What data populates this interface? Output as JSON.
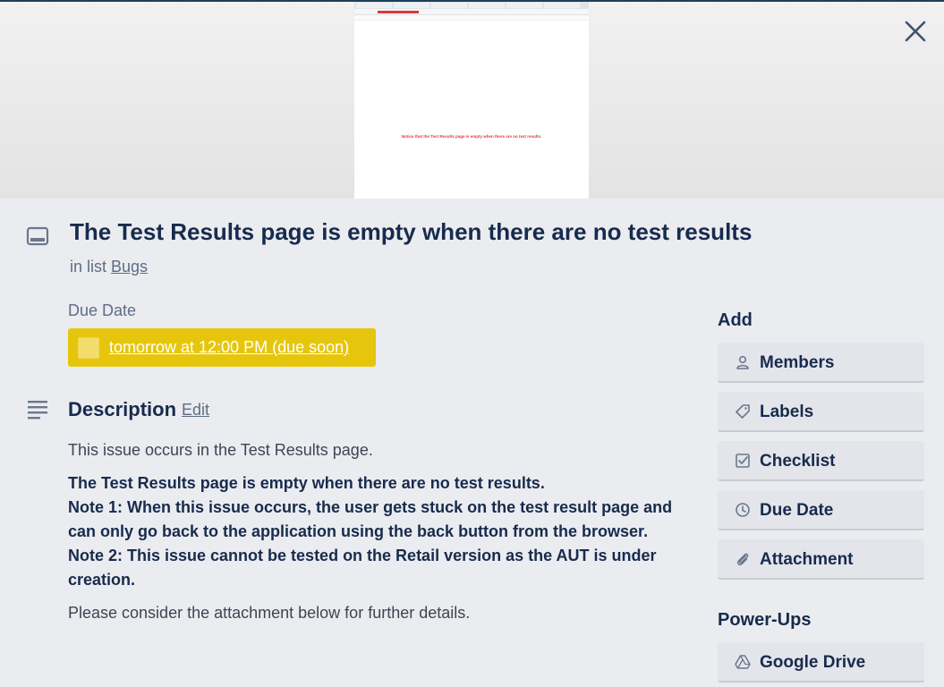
{
  "cover": {
    "thumbnail_note": "Notice that the Test Results page is empty when there are no test results."
  },
  "card": {
    "title": "The Test Results page is empty when there are no test results",
    "in_list_prefix": "in list",
    "list_name": "Bugs"
  },
  "due_date": {
    "label": "Due Date",
    "value": "tomorrow at 12:00 PM (due soon)",
    "badge_color": "#e6c60d"
  },
  "description": {
    "title": "Description",
    "edit_label": "Edit",
    "intro": "This issue occurs in the Test Results page.",
    "bold_lines": [
      "The Test Results page is empty when there are no test results.",
      "Note 1: When this issue occurs, the user gets stuck on the test result page and can only go back to the application using the back button from the browser.",
      "Note 2: This issue cannot be tested on the Retail version as the AUT is under creation."
    ],
    "outro": "Please consider the attachment below for further details."
  },
  "sidebar": {
    "add_heading": "Add",
    "add_buttons": [
      {
        "label": "Members",
        "icon": "person-icon"
      },
      {
        "label": "Labels",
        "icon": "tag-icon"
      },
      {
        "label": "Checklist",
        "icon": "checkbox-icon"
      },
      {
        "label": "Due Date",
        "icon": "clock-icon"
      },
      {
        "label": "Attachment",
        "icon": "paperclip-icon"
      }
    ],
    "powerups_heading": "Power-Ups",
    "powerup_buttons": [
      {
        "label": "Google Drive",
        "icon": "google-drive-icon"
      }
    ]
  }
}
